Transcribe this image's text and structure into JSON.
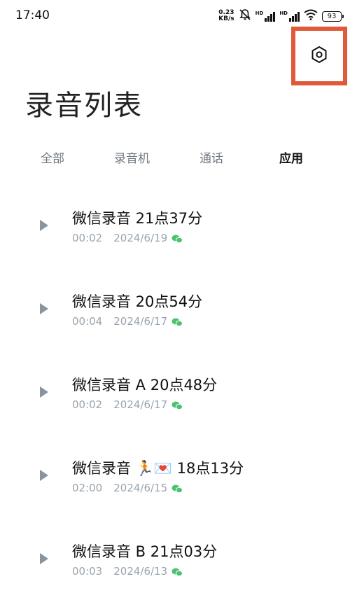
{
  "status_bar": {
    "time": "17:40",
    "net_speed_value": "0.23",
    "net_speed_unit": "KB/s",
    "signal_label": "HD",
    "battery": "93",
    "icons": [
      "mute-bell-icon",
      "signal-icon",
      "signal-icon",
      "wifi-icon",
      "battery-icon"
    ]
  },
  "header": {
    "title": "录音列表",
    "settings_icon": "hexagon-settings-icon",
    "highlight_color": "#e05a3a"
  },
  "tabs": [
    {
      "label": "全部",
      "active": false
    },
    {
      "label": "录音机",
      "active": false
    },
    {
      "label": "通话",
      "active": false
    },
    {
      "label": "应用",
      "active": true
    }
  ],
  "recordings": [
    {
      "title": "微信录音  21点37分",
      "duration": "00:02",
      "date": "2024/6/19",
      "source_icon": "wechat-icon"
    },
    {
      "title": "微信录音  20点54分",
      "duration": "00:04",
      "date": "2024/6/17",
      "source_icon": "wechat-icon"
    },
    {
      "title": "微信录音 A 20点48分",
      "duration": "00:02",
      "date": "2024/6/17",
      "source_icon": "wechat-icon"
    },
    {
      "title": "微信录音 🏃💌 18点13分",
      "duration": "02:00",
      "date": "2024/6/15",
      "source_icon": "wechat-icon"
    },
    {
      "title": "微信录音 B 21点03分",
      "duration": "00:03",
      "date": "2024/6/13",
      "source_icon": "wechat-icon"
    }
  ],
  "colors": {
    "play_icon": "#8a949e",
    "meta_text": "#9aa4ad",
    "wechat_green": "#4cc26e"
  }
}
